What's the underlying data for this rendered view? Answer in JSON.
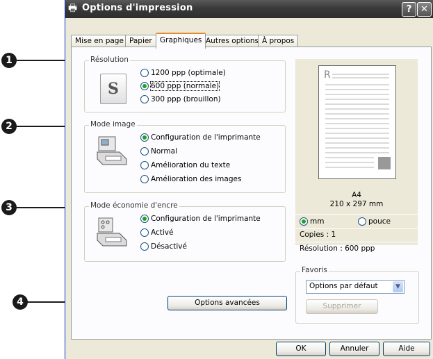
{
  "window": {
    "title": "Options d'impression",
    "help_label": "?",
    "close_label": "✕"
  },
  "tabs": [
    {
      "label": "Mise en page"
    },
    {
      "label": "Papier"
    },
    {
      "label": "Graphiques"
    },
    {
      "label": "Autres options"
    },
    {
      "label": "À propos"
    }
  ],
  "resolution": {
    "label": "Résolution",
    "options": [
      {
        "label": "1200 ppp (optimale)",
        "selected": false
      },
      {
        "label": "600 ppp (normale)",
        "selected": true
      },
      {
        "label": "300 ppp (brouillon)",
        "selected": false
      }
    ]
  },
  "image_mode": {
    "label": "Mode image",
    "options": [
      {
        "label": "Configuration de l'imprimante",
        "selected": true
      },
      {
        "label": "Normal",
        "selected": false
      },
      {
        "label": "Amélioration du texte",
        "selected": false
      },
      {
        "label": "Amélioration des images",
        "selected": false
      }
    ]
  },
  "toner_save": {
    "label": "Mode économie d'encre",
    "options": [
      {
        "label": "Configuration de l'imprimante",
        "selected": true
      },
      {
        "label": "Activé",
        "selected": false
      },
      {
        "label": "Désactivé",
        "selected": false
      }
    ]
  },
  "advanced_button": "Options avancées",
  "preview": {
    "paper": "A4",
    "size": "210 x 297 mm",
    "unit_mm": "mm",
    "unit_inch": "pouce",
    "unit_selected": "mm",
    "copies": "Copies : 1",
    "resolution": "Résolution : 600 ppp"
  },
  "favorites": {
    "label": "Favoris",
    "selected": "Options par défaut",
    "delete_label": "Supprimer"
  },
  "buttons": {
    "ok": "OK",
    "cancel": "Annuler",
    "help": "Aide"
  },
  "callouts": [
    "1",
    "2",
    "3",
    "4"
  ]
}
